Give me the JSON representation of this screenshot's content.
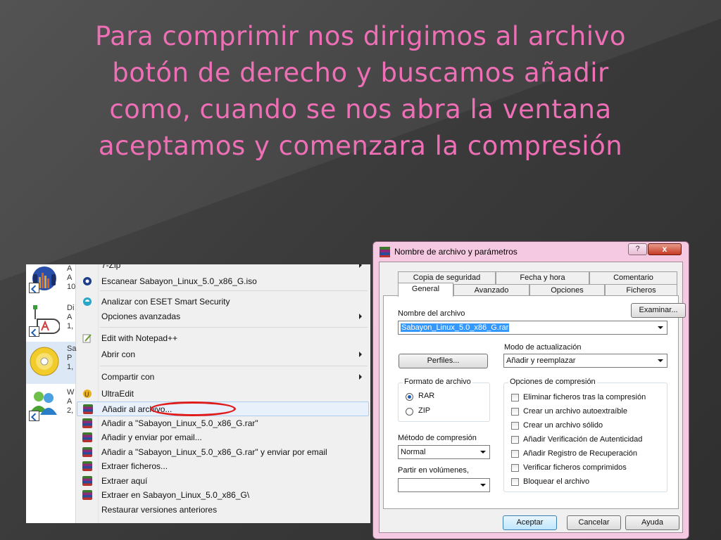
{
  "slide": {
    "title": "Para comprimir nos dirigimos al archivo botón de derecho y buscamos añadir como, cuando se nos abra la ventana aceptamos y comenzara la compresión",
    "accent_color": "#ee6fb6"
  },
  "explorer": {
    "files": [
      {
        "name": "A",
        "line2": "A",
        "line3": "10",
        "icon": "audio-app-icon"
      },
      {
        "name": "Di",
        "line2": "A",
        "line3": "1,",
        "icon": "diagram-app-icon"
      },
      {
        "name": "Sa",
        "line2": "P",
        "line3": "1,",
        "icon": "disc-image-icon"
      },
      {
        "name": "W",
        "line2": "A",
        "line3": "2,",
        "icon": "messenger-users-icon"
      }
    ]
  },
  "context_menu": {
    "items": [
      {
        "label": "7-Zip",
        "icon": "",
        "submenu": true
      },
      {
        "label": "Escanear Sabayon_Linux_5.0_x86_G.iso",
        "icon": "scan-icon"
      },
      {
        "label": "Analizar con ESET Smart Security",
        "icon": "eset-icon"
      },
      {
        "label": "Opciones avanzadas",
        "icon": "",
        "submenu": true
      },
      {
        "label": "Edit with Notepad++",
        "icon": "notepad-icon"
      },
      {
        "label": "Abrir con",
        "icon": "",
        "submenu": true
      },
      {
        "label": "Compartir con",
        "icon": "",
        "submenu": true
      },
      {
        "label": "UltraEdit",
        "icon": "ultraedit-icon"
      },
      {
        "label": "Añadir al archivo...",
        "icon": "winrar-icon",
        "highlighted": true
      },
      {
        "label": "Añadir a \"Sabayon_Linux_5.0_x86_G.rar\"",
        "icon": "winrar-icon"
      },
      {
        "label": "Añadir y enviar por email...",
        "icon": "winrar-icon"
      },
      {
        "label": "Añadir a \"Sabayon_Linux_5.0_x86_G.rar\" y enviar por email",
        "icon": "winrar-icon"
      },
      {
        "label": "Extraer ficheros...",
        "icon": "winrar-icon"
      },
      {
        "label": "Extraer aquí",
        "icon": "winrar-icon"
      },
      {
        "label": "Extraer en Sabayon_Linux_5.0_x86_G\\",
        "icon": "winrar-icon"
      },
      {
        "label": "Restaurar versiones anteriores",
        "icon": ""
      }
    ],
    "annotation_color": "#e11a1a"
  },
  "dialog": {
    "title": "Nombre de archivo y parámetros",
    "help_label": "?",
    "close_label": "x",
    "tabs_row1": [
      "Copia de seguridad",
      "Fecha y hora",
      "Comentario"
    ],
    "tabs_row2": [
      "General",
      "Avanzado",
      "Opciones",
      "Ficheros"
    ],
    "active_tab": "General",
    "archive_name_label": "Nombre del archivo",
    "browse_label": "Examinar...",
    "archive_name_value": "Sabayon_Linux_5.0_x86_G.rar",
    "update_mode_label": "Modo de actualización",
    "profiles_label": "Perfiles...",
    "update_mode_value": "Añadir y reemplazar",
    "format_group": {
      "title": "Formato de archivo",
      "options": [
        {
          "label": "RAR",
          "selected": true
        },
        {
          "label": "ZIP",
          "selected": false
        }
      ]
    },
    "method_label": "Método de compresión",
    "method_value": "Normal",
    "split_label": "Partir en volúmenes,",
    "split_value": "",
    "options_group": {
      "title": "Opciones de compresión",
      "options": [
        {
          "label": "Eliminar ficheros tras la compresión",
          "checked": false
        },
        {
          "label": "Crear un archivo autoextraíble",
          "checked": false
        },
        {
          "label": "Crear un archivo sólido",
          "checked": false
        },
        {
          "label": "Añadir Verificación de Autenticidad",
          "checked": false
        },
        {
          "label": "Añadir Registro de Recuperación",
          "checked": false
        },
        {
          "label": "Verificar ficheros comprimidos",
          "checked": false
        },
        {
          "label": "Bloquear el archivo",
          "checked": false
        }
      ]
    },
    "buttons": {
      "ok": "Aceptar",
      "cancel": "Cancelar",
      "help": "Ayuda"
    }
  }
}
